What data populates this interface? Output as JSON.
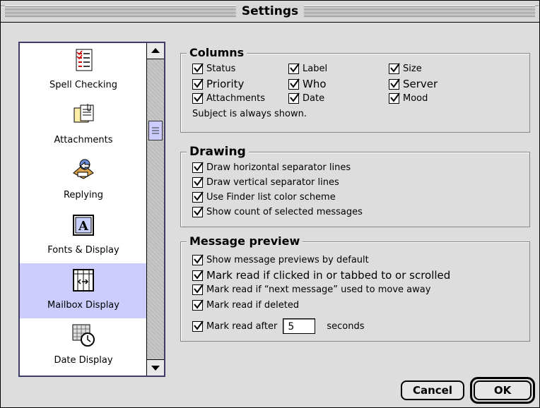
{
  "window": {
    "title": "Settings"
  },
  "sidebar": {
    "items": [
      {
        "label": "Spell Checking",
        "icon": "spell-checking-icon"
      },
      {
        "label": "Attachments",
        "icon": "attachments-icon"
      },
      {
        "label": "Replying",
        "icon": "replying-icon"
      },
      {
        "label": "Fonts & Display",
        "icon": "fonts-display-icon"
      },
      {
        "label": "Mailbox Display",
        "icon": "mailbox-display-icon",
        "selected": true
      },
      {
        "label": "Date Display",
        "icon": "date-display-icon"
      }
    ]
  },
  "columns": {
    "title": "Columns",
    "items": [
      {
        "label": "Status",
        "checked": true
      },
      {
        "label": "Label",
        "checked": true
      },
      {
        "label": "Size",
        "checked": true
      },
      {
        "label": "Priority",
        "checked": true
      },
      {
        "label": "Who",
        "checked": true
      },
      {
        "label": "Server",
        "checked": true
      },
      {
        "label": "Attachments",
        "checked": true
      },
      {
        "label": "Date",
        "checked": true
      },
      {
        "label": "Mood",
        "checked": true
      }
    ],
    "note": "Subject is always shown."
  },
  "drawing": {
    "title": "Drawing",
    "items": [
      {
        "label": "Draw horizontal separator lines",
        "checked": true
      },
      {
        "label": "Draw vertical separator lines",
        "checked": true
      },
      {
        "label": "Use Finder list color scheme",
        "checked": true
      },
      {
        "label": "Show count of selected messages",
        "checked": true
      }
    ]
  },
  "preview": {
    "title": "Message preview",
    "items": [
      {
        "label": "Show message previews by default",
        "checked": true
      },
      {
        "label": "Mark read if clicked in or tabbed to or scrolled",
        "checked": true
      },
      {
        "label": "Mark read if “next message” used to move away",
        "checked": true
      },
      {
        "label": "Mark read if deleted",
        "checked": true
      }
    ],
    "mark_after_label": "Mark read after",
    "mark_after_value": "5",
    "mark_after_unit": "seconds"
  },
  "buttons": {
    "cancel": "Cancel",
    "ok": "OK"
  },
  "colors": {
    "selection": "#ccccff",
    "window_bg": "#dddddd"
  }
}
